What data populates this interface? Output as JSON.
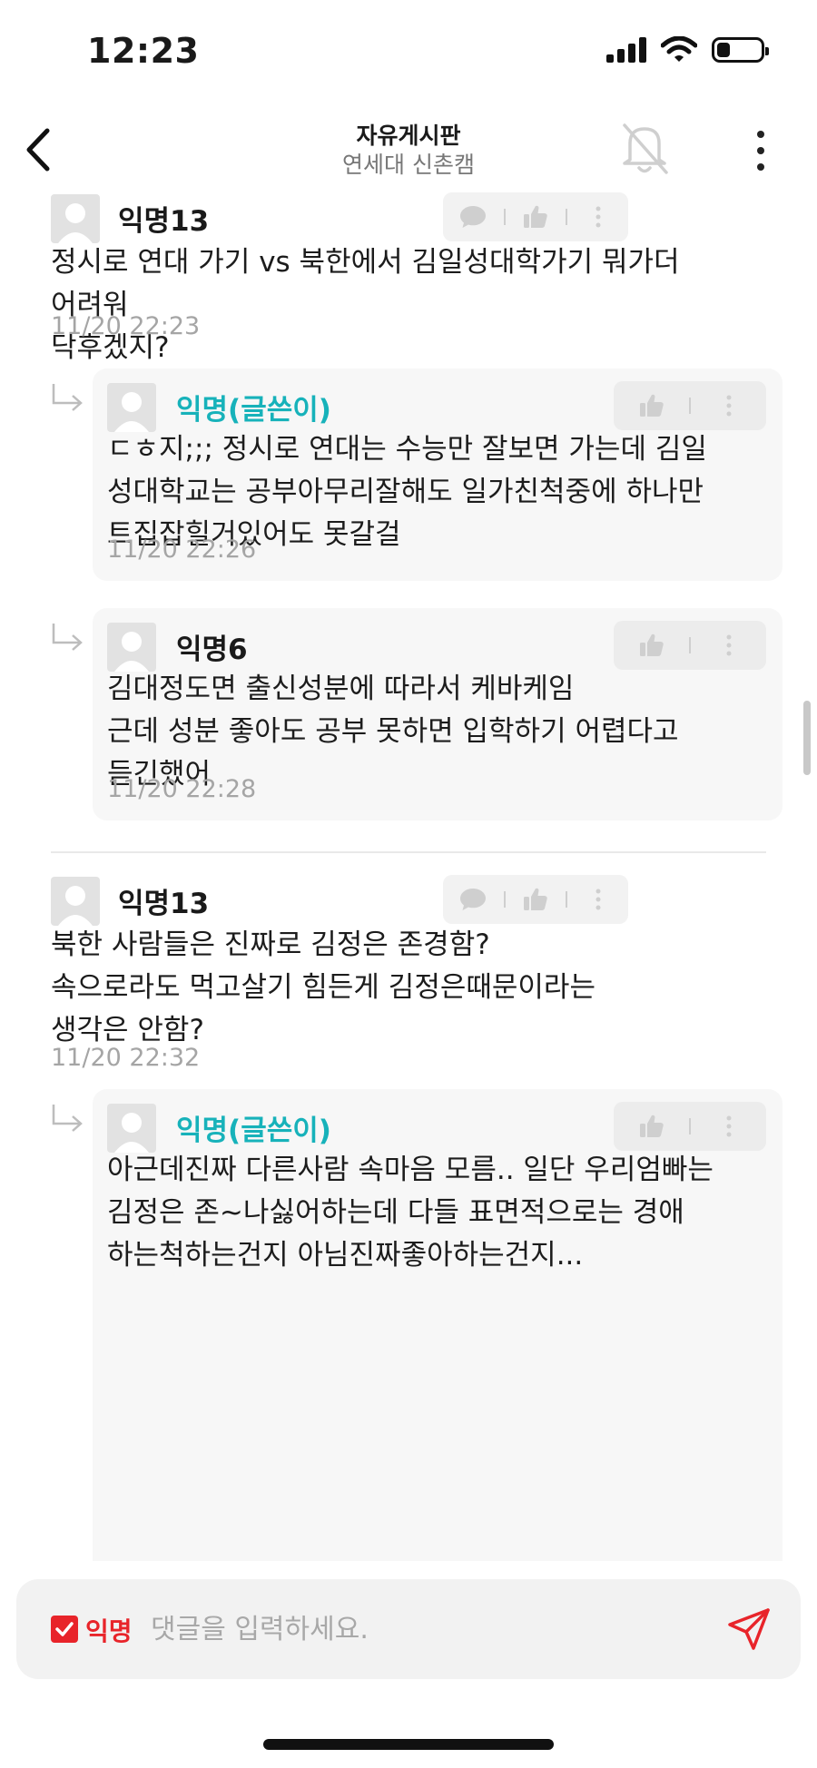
{
  "status_bar": {
    "time": "12:23",
    "battery_fraction": 0.3
  },
  "header": {
    "title": "자유게시판",
    "subtitle": "연세대 신촌캠"
  },
  "comments": [
    {
      "nickname": "익명13",
      "text": "정시로 연대 가기 vs 북한에서 김일성대학가기 뭐가더\n어려워\n닥후겠지?",
      "time": "11/20 22:23",
      "replies": [
        {
          "nickname": "익명(글쓴이)",
          "text": "ㄷㅎ지;;; 정시로 연대는 수능만 잘보면 가는데 김일\n성대학교는 공부아무리잘해도 일가친척중에 하나만\n트집잡힐거있어도 못갈걸",
          "time": "11/20 22:26"
        },
        {
          "nickname": "익명6",
          "text": "김대정도면 출신성분에 따라서 케바케임\n근데 성분 좋아도 공부 못하면 입학하기 어렵다고\n듣긴했어",
          "time": "11/20 22:28"
        }
      ]
    },
    {
      "nickname": "익명13",
      "text": "북한 사람들은 진짜로 김정은 존경함?\n속으로라도 먹고살기 힘든게 김정은때문이라는\n생각은 안함?",
      "time": "11/20 22:32",
      "replies": [
        {
          "nickname": "익명(글쓴이)",
          "text": "아근데진짜 다른사람 속마음 모름.. 일단 우리엄빠는\n김정은 존~나싫어하는데 다들 표면적으로는 경애\n하는척하는건지 아님진짜좋아하는건지..."
        }
      ]
    }
  ],
  "input_bar": {
    "anonymous_label": "익명",
    "anonymous_checked": true,
    "placeholder": "댓글을 입력하세요."
  },
  "colors": {
    "op_nickname": "#17b2ba",
    "accent_red": "#e8242a"
  }
}
